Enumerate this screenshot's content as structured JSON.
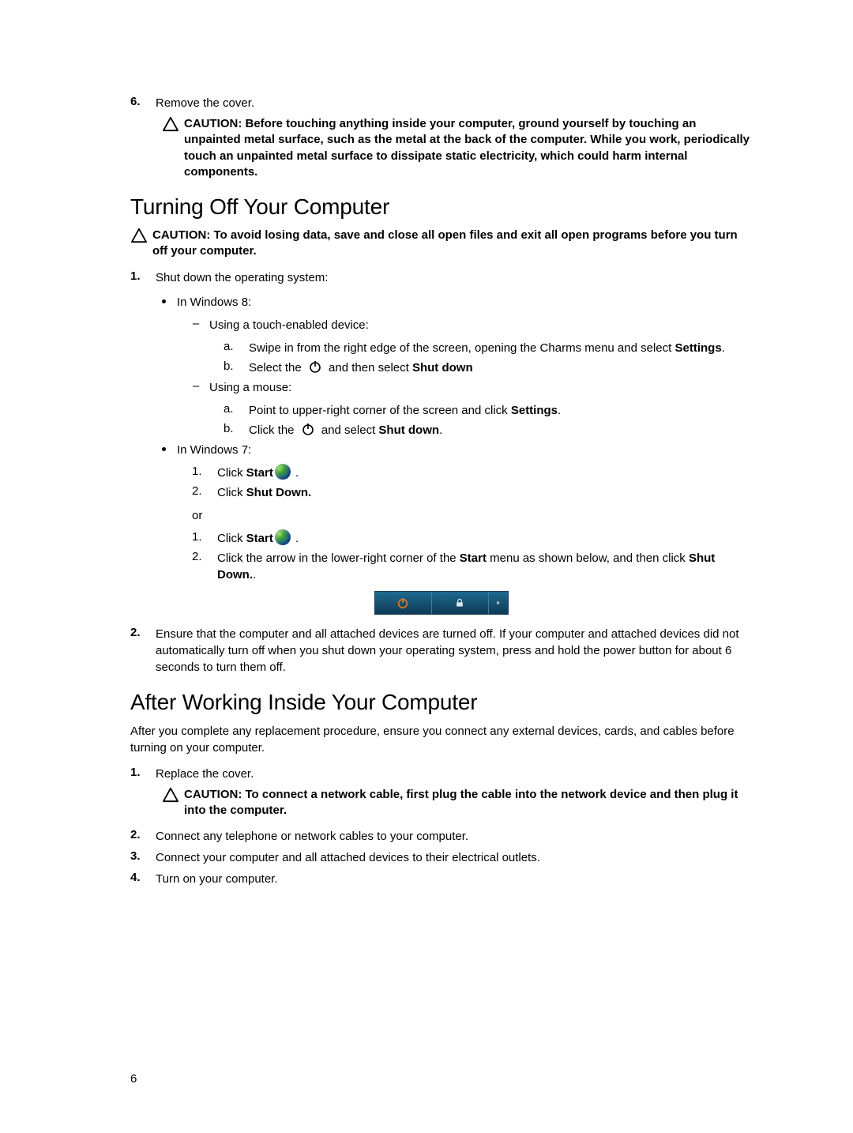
{
  "step6": {
    "num": "6.",
    "text": "Remove the cover."
  },
  "caution1": "CAUTION: Before touching anything inside your computer, ground yourself by touching an unpainted metal surface, such as the metal at the back of the computer. While you work, periodically touch an unpainted metal surface to dissipate static electricity, which could harm internal components.",
  "heading1": "Turning Off Your Computer",
  "caution2": "CAUTION: To avoid losing data, save and close all open files and exit all open programs before you turn off your computer.",
  "ol": {
    "s1": {
      "num": "1.",
      "text": "Shut down the operating system:"
    },
    "win8": "In Windows 8:",
    "touch": "Using a touch-enabled device:",
    "t_a": {
      "mark": "a.",
      "pre": "Swipe in from the right edge of the screen, opening the Charms menu and select ",
      "bold": "Settings",
      "post": "."
    },
    "t_b": {
      "mark": "b.",
      "pre": "Select the ",
      "mid": " and then select ",
      "bold": "Shut down"
    },
    "mouse": "Using a mouse:",
    "m_a": {
      "mark": "a.",
      "pre": "Point to upper-right corner of the screen and click ",
      "bold": "Settings",
      "post": "."
    },
    "m_b": {
      "mark": "b.",
      "pre": "Click the ",
      "mid": " and select ",
      "bold": "Shut down",
      "post": "."
    },
    "win7": "In Windows 7:",
    "w7_1": {
      "mark": "1.",
      "pre": "Click ",
      "bold": "Start",
      "post": " ."
    },
    "w7_2": {
      "mark": "2.",
      "pre": "Click ",
      "bold": "Shut Down."
    },
    "or": "or",
    "w7b_1": {
      "mark": "1.",
      "pre": "Click ",
      "bold": "Start",
      "post": " ."
    },
    "w7b_2": {
      "mark": "2.",
      "pre": "Click the arrow in the lower-right corner of the ",
      "bold1": "Start",
      "mid": " menu as shown below, and then click ",
      "bold2": "Shut Down.",
      "post": "."
    },
    "s2": {
      "num": "2.",
      "text": "Ensure that the computer and all attached devices are turned off. If your computer and attached devices did not automatically turn off when you shut down your operating system, press and hold the power button for about 6 seconds to turn them off."
    }
  },
  "heading2": "After Working Inside Your Computer",
  "para2": "After you complete any replacement procedure, ensure you connect any external devices, cards, and cables before turning on your computer.",
  "after": {
    "s1": {
      "num": "1.",
      "text": "Replace the cover."
    },
    "caution": "CAUTION: To connect a network cable, first plug the cable into the network device and then plug it into the computer.",
    "s2": {
      "num": "2.",
      "text": "Connect any telephone or network cables to your computer."
    },
    "s3": {
      "num": "3.",
      "text": "Connect your computer and all attached devices to their electrical outlets."
    },
    "s4": {
      "num": "4.",
      "text": "Turn on your computer."
    }
  },
  "pagenum": "6"
}
